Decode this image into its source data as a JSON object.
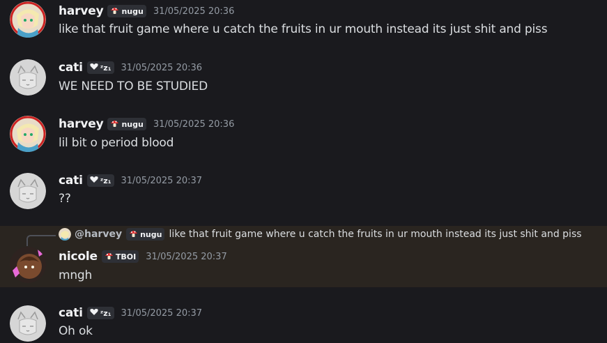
{
  "messages": [
    {
      "author": "harvey",
      "tag": "nugu",
      "time": "31/05/2025 20:36",
      "text": "like that fruit game where u catch the fruits in ur mouth instead its just shit and piss"
    },
    {
      "author": "cati",
      "tag": "ᶻz₁",
      "time": "31/05/2025 20:36",
      "text": "WE NEED TO BE STUDIED"
    },
    {
      "author": "harvey",
      "tag": "nugu",
      "time": "31/05/2025 20:36",
      "text": "lil bit o period blood"
    },
    {
      "author": "cati",
      "tag": "ᶻz₁",
      "time": "31/05/2025 20:37",
      "text": "??"
    },
    {
      "author": "nicole",
      "tag": "TBOI",
      "time": "31/05/2025 20:37",
      "text": "mngh",
      "reply": {
        "author": "@harvey",
        "tag": "nugu",
        "text": "like that fruit game where u catch the fruits in ur mouth instead its just shit and piss"
      }
    },
    {
      "author": "cati",
      "tag": "ᶻz₁",
      "time": "31/05/2025 20:37",
      "text": "Oh ok"
    }
  ],
  "colors": {
    "background": "#1a1a1e",
    "mention_highlight": "#2a2520",
    "timestamp": "#949ba4",
    "name": "#f2f3f5"
  },
  "icons": {
    "mushroom": "mushroom-icon",
    "heart": "heart-icon"
  }
}
